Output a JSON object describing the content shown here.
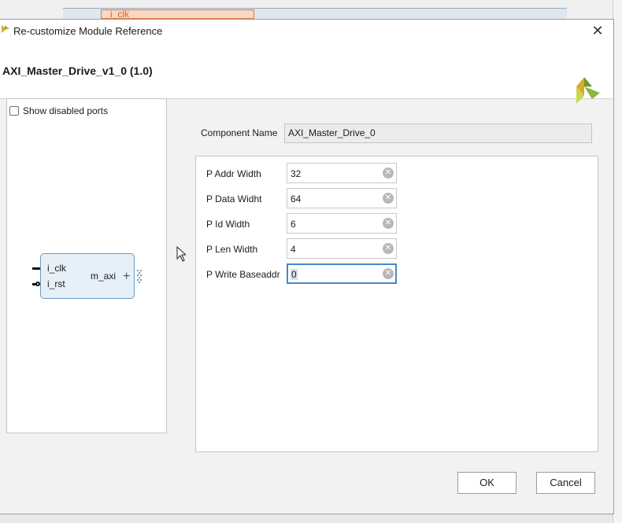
{
  "background": {
    "wire_label": "i_clk"
  },
  "dialog": {
    "title": "Re-customize Module Reference",
    "close_icon": "close-icon",
    "header_title": "AXI_Master_Drive_v1_0 (1.0)",
    "brand_icon": "vivado-logo-icon"
  },
  "symbol_panel": {
    "show_disabled_ports_label": "Show disabled ports",
    "show_disabled_ports_checked": false,
    "block": {
      "ports_in": [
        "i_clk",
        "i_rst"
      ],
      "port_out": "m_axi"
    }
  },
  "component": {
    "label": "Component Name",
    "value": "AXI_Master_Drive_0"
  },
  "params": [
    {
      "label": "P Addr Width",
      "value": "32"
    },
    {
      "label": "P Data Widht",
      "value": "64"
    },
    {
      "label": "P Id Width",
      "value": "6"
    },
    {
      "label": "P Len Width",
      "value": "4"
    },
    {
      "label": "P Write Baseaddr",
      "value": "0",
      "focused": true
    }
  ],
  "buttons": {
    "ok": "OK",
    "cancel": "Cancel"
  },
  "colors": {
    "accent": "#4a86c8",
    "block_fill": "#e6f0f8",
    "block_border": "#6e97bd",
    "logo_green": "#8cb63c"
  }
}
